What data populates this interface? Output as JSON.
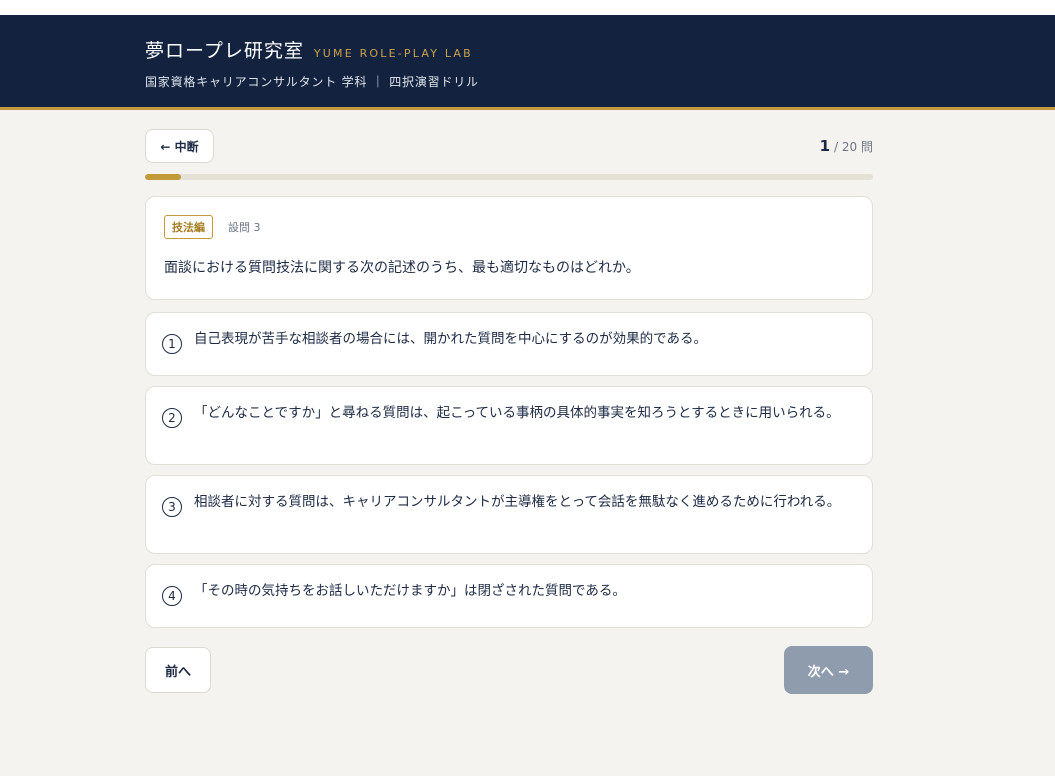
{
  "header": {
    "title": "夢ロープレ研究室",
    "subtitle": "YUME ROLE-PLAY LAB",
    "tagline": "国家資格キャリアコンサルタント 学科 ｜ 四択演習ドリル"
  },
  "nav": {
    "back_label": "← 中断",
    "current": "1",
    "total": "/ 20 問",
    "progress_fraction": 0.05
  },
  "question": {
    "tag": "技法編",
    "number": "設問 3",
    "text": "面談における質問技法に関する次の記述のうち、最も適切なものはどれか。"
  },
  "options": [
    {
      "num": "1",
      "text": "自己表現が苦手な相談者の場合には、開かれた質問を中心にするのが効果的である。"
    },
    {
      "num": "2",
      "text": "「どんなことですか」と尋ねる質問は、起こっている事柄の具体的事実を知ろうとするときに用いられる。"
    },
    {
      "num": "3",
      "text": "相談者に対する質問は、キャリアコンサルタントが主導権をとって会話を無駄なく進めるために行われる。"
    },
    {
      "num": "4",
      "text": "「その時の気持ちをお話しいただけますか」は閉ざされた質問である。"
    }
  ],
  "footer": {
    "prev_label": "前へ",
    "next_label": "次へ →"
  },
  "colors": {
    "navy": "#13233f",
    "gold": "#c29a3a",
    "next_disabled": "#8f9cae"
  }
}
